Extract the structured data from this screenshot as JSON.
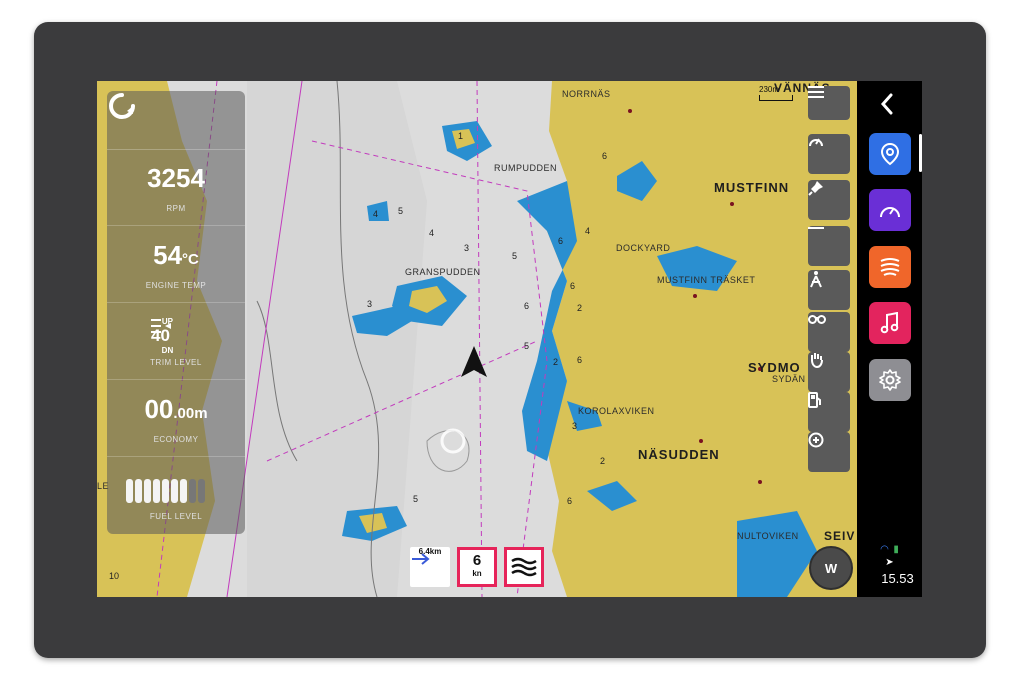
{
  "scale_label": "230m",
  "places": {
    "vannas": "VÄNNÄS",
    "norrnas": "NORRNÄS",
    "rumpudden": "RUMPUDDEN",
    "mustfinn": "MUSTFINN",
    "dockyard": "DOCKYARD",
    "mustfinn_trasket": "MUSTFINN TRÄSKET",
    "gransudden": "GRANSPUDDEN",
    "sydmo": "SYDMO",
    "sydan": "SYDÄN",
    "korolaxviken": "KOROLAXVIKEN",
    "nasudden": "NÄSUDDEN",
    "nultoviken": "NULTOVIKEN",
    "seiv": "SEIV",
    "le": "LE"
  },
  "depths": [
    "1",
    "5",
    "6",
    "4",
    "6",
    "3",
    "6",
    "4",
    "5",
    "4",
    "2",
    "3",
    "6",
    "5",
    "2",
    "6",
    "3",
    "2",
    "6",
    "5",
    "10"
  ],
  "gauges": {
    "refresh_icon": "refresh-icon",
    "rpm": {
      "value": "3254",
      "label": "RPM"
    },
    "engine_temp": {
      "value": "54",
      "unit": "°C",
      "label": "ENGINE TEMP"
    },
    "trim": {
      "up": "UP",
      "value": "40",
      "dn": "DN",
      "label": "TRIM LEVEL"
    },
    "economy": {
      "value": "00",
      "decimal": ".00",
      "unit": "m",
      "label": "ECONOMY"
    },
    "fuel": {
      "label": "FUEL LEVEL",
      "segments_on": 7,
      "segments_total": 9
    }
  },
  "tools": [
    {
      "name": "menu-icon"
    },
    {
      "name": "gauge-icon"
    },
    {
      "name": "pin-icon"
    },
    {
      "name": "minus-icon"
    },
    {
      "name": "person-icon"
    },
    {
      "name": "binoculars-icon"
    },
    {
      "name": "hand-icon"
    },
    {
      "name": "fuel-icon"
    },
    {
      "name": "add-location-icon"
    }
  ],
  "bottom": {
    "distance": "6.4km",
    "speed_value": "6",
    "speed_unit": "kn",
    "compass": "W"
  },
  "sidebar": {
    "apps": [
      {
        "name": "navigation-app",
        "icon": "location-pin-icon",
        "color": "#2f6fe4"
      },
      {
        "name": "gauges-app",
        "icon": "speedometer-icon",
        "color": "#6a2fd6"
      },
      {
        "name": "sonar-app",
        "icon": "sonar-icon",
        "color": "#f0662a"
      },
      {
        "name": "music-app",
        "icon": "music-note-icon",
        "color": "#e3245e"
      },
      {
        "name": "settings-app",
        "icon": "gear-icon",
        "color": "#8e8e93"
      }
    ],
    "time": "15.53"
  },
  "colors": {
    "land": "#d8c257",
    "water": "#2a8fd0",
    "bezel": "#3b3b3d",
    "accent": "#e6245a"
  }
}
